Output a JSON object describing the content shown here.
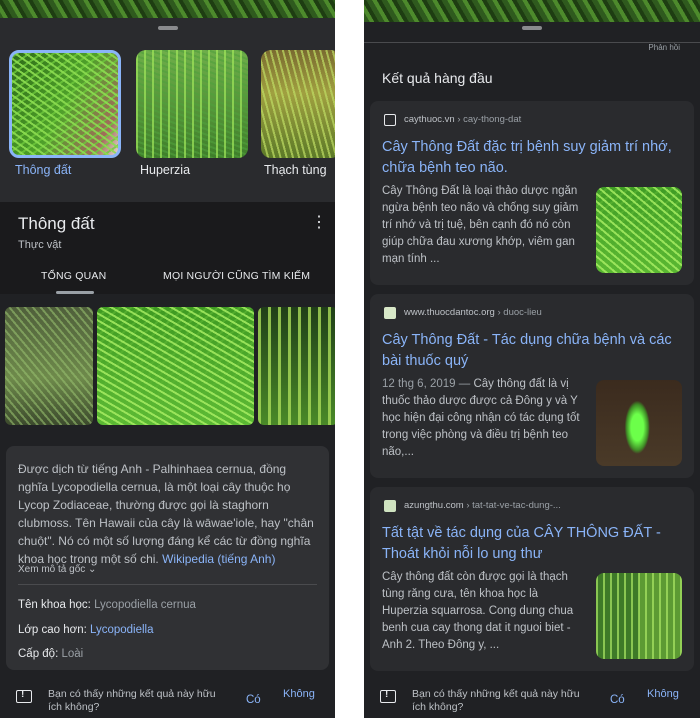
{
  "left": {
    "thumbnails": [
      {
        "label": "Thông đất",
        "selected": true
      },
      {
        "label": "Huperzia",
        "selected": false
      },
      {
        "label": "Thạch tùng",
        "selected": false
      }
    ],
    "panel": {
      "title": "Thông đất",
      "subtitle": "Thực vật",
      "tabs": [
        "TỔNG QUAN",
        "MỌI NGƯỜI CŨNG TÌM KIẾM"
      ]
    },
    "description": {
      "text": "Được dịch từ tiếng Anh - Palhinhaea cernua, đồng nghĩa Lycopodiella cernua, là một loại cây thuộc họ Lycop Zodiaceae, thường được gọi là staghorn clubmoss. Tên Hawaii của cây là wāwae'iole, hay \"chân chuột\". Nó có một số lượng đáng kể các từ đồng nghĩa khoa học trong một số chi. ",
      "link": "Wikipedia (tiếng Anh)",
      "more": "Xem mô tả gốc",
      "facts": [
        {
          "label": "Tên khoa học: ",
          "value": "Lycopodiella cernua"
        },
        {
          "label": "Lớp cao hơn: ",
          "value": "Lycopodiella"
        },
        {
          "label": "Cấp độ: ",
          "value": "Loài"
        }
      ]
    }
  },
  "feedback": {
    "question": "Bạn có thấy những kết quả này hữu ích không?",
    "yes": "Có",
    "no": "Không"
  },
  "right": {
    "top_label": "Phản hồi",
    "section_title": "Kết quả hàng đầu",
    "results": [
      {
        "domain": "caythuoc.vn",
        "path": " › cay-thong-dat",
        "title": "Cây Thông Đất đặc trị bệnh suy giảm trí nhớ, chữa bệnh teo não.",
        "date": "",
        "snippet": "Cây Thông Đất là loại thảo dược ngăn ngừa bệnh teo não và chống suy giảm trí nhớ và trị tuệ, bên cạnh đó nó còn giúp chữa đau xương khớp, viêm gan mạn tính  ..."
      },
      {
        "domain": "www.thuocdantoc.org",
        "path": " › duoc-lieu",
        "title": "Cây Thông Đất - Tác dụng chữa bệnh và các bài thuốc quý",
        "date": "12 thg 6, 2019 — ",
        "snippet": "Cây thông đất là vị thuốc thảo dược được cả Đông y và Y học hiện đại công nhận có tác dụng tốt trong việc phòng và điều trị bệnh teo não,..."
      },
      {
        "domain": "azungthu.com",
        "path": " › tat-tat-ve-tac-dung-...",
        "title": "Tất tật về tác dụng của CÂY THÔNG ĐẤT - Thoát khỏi nỗi lo ung thư",
        "date": "",
        "snippet": "Cây thông đất còn được gọi là thạch tùng răng cưa, tên khoa học là Huperzia squarrosa. Cong dung chua benh cua cay thong dat it nguoi biet - Anh 2. Theo Đông y, ..."
      }
    ]
  }
}
